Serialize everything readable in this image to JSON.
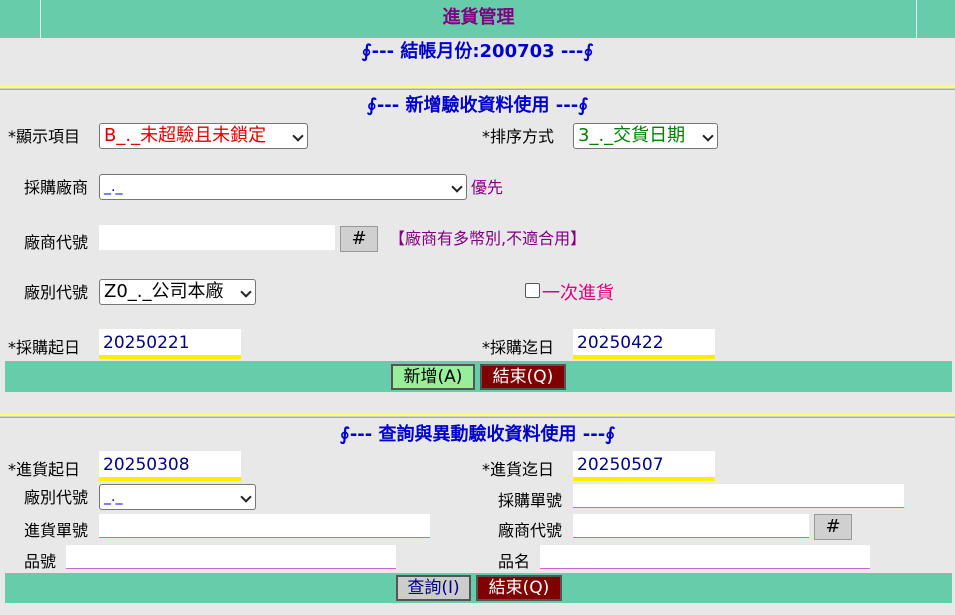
{
  "header": {
    "title": "進貨管理",
    "month_banner": "∮--- 結帳月份:200703 ---∮"
  },
  "add_section": {
    "title": "∮--- 新增驗收資料使用 ---∮",
    "display_label": "*顯示項目",
    "display_value": "B_._未超驗且未鎖定",
    "sort_label": "*排序方式",
    "sort_value": "3_._交貨日期",
    "vendor_label": "採購廠商",
    "vendor_value": "_._",
    "priority_text": "優先",
    "vendor_code_label": "廠商代號",
    "vendor_code_value": "",
    "hash_label": "#",
    "vendor_note": "【廠商有多幣別,不適合用】",
    "factory_label": "廠別代號",
    "factory_value": "Z0_._公司本廠",
    "one_time_label": "一次進貨",
    "start_label": "*採購起日",
    "start_value": "20250221",
    "end_label": "*採購迄日",
    "end_value": "20250422",
    "add_button": "新增(A)",
    "exit_button": "結束(Q)"
  },
  "query_section": {
    "title": "∮--- 查詢與異動驗收資料使用 ---∮",
    "start_label": "*進貨起日",
    "start_value": "20250308",
    "end_label": "*進貨迄日",
    "end_value": "20250507",
    "factory_label": "廠別代號",
    "factory_value": "_._",
    "po_label": "採購單號",
    "po_value": "",
    "receipt_label": "進貨單號",
    "receipt_value": "",
    "vendor_code_label": "廠商代號",
    "vendor_code_value": "",
    "hash_label": "#",
    "item_no_label": "品號",
    "item_no_value": "",
    "item_name_label": "品名",
    "item_name_value": "",
    "query_button": "查詢(I)",
    "exit_button": "結束(Q)"
  },
  "colors": {
    "header_green": "#66ccaa",
    "title_purple": "#800080",
    "banner_blue": "#0000cc",
    "date_underline": "#ffee00"
  }
}
